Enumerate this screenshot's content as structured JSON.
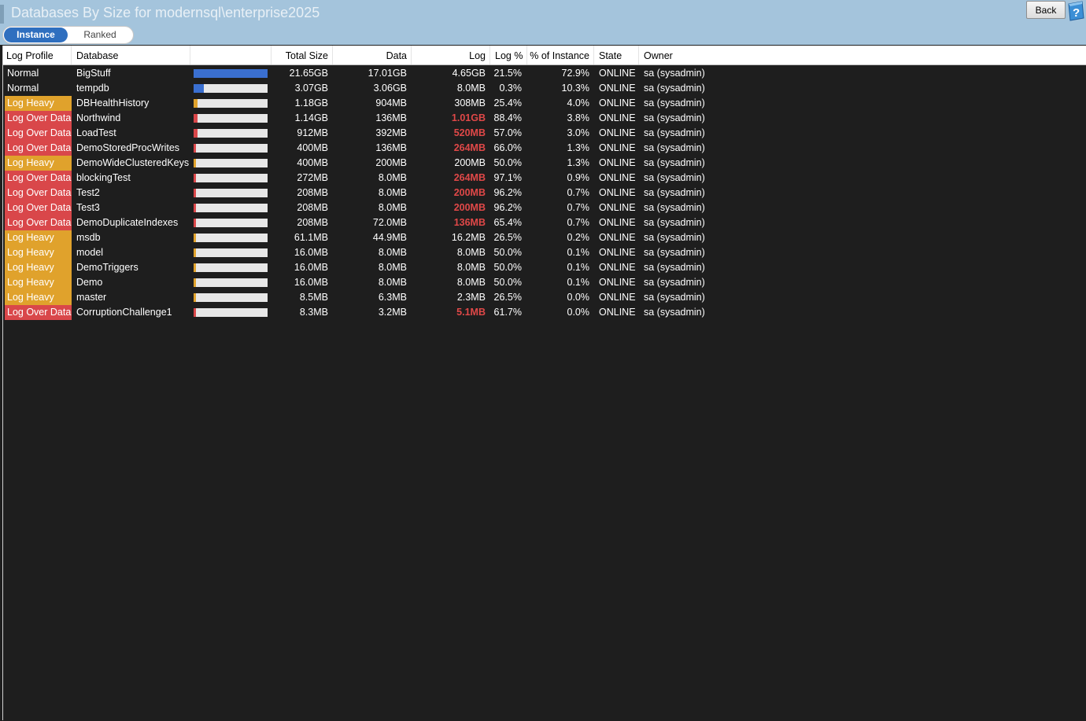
{
  "window": {
    "title": "Databases By Size for modernsql\\enterprise2025",
    "back_label": "Back"
  },
  "view_toggle": {
    "instance_label": "Instance",
    "ranked_label": "Ranked",
    "selected": "Instance"
  },
  "colors": {
    "normal": "#1e1e1e",
    "log_heavy": "#e0a22c",
    "log_over_data": "#d9474a",
    "bar_blue": "#3a6fd0",
    "bar_track": "#e7e7e7",
    "log_red_text": "#e04848"
  },
  "columns": [
    "Log Profile",
    "Database",
    "",
    "Total Size",
    "Data",
    "Log",
    "Log %",
    "% of Instance",
    "State",
    "Owner"
  ],
  "rows": [
    {
      "profile": "Normal",
      "database": "BigStuff",
      "total": "21.65GB",
      "data": "17.01GB",
      "log": "4.65GB",
      "log_pct": "21.5%",
      "pct_instance": "72.9%",
      "state": "ONLINE",
      "owner": "sa (sysadmin)",
      "bar_fraction": 1.0,
      "log_highlight": false
    },
    {
      "profile": "Normal",
      "database": "tempdb",
      "total": "3.07GB",
      "data": "3.06GB",
      "log": "8.0MB",
      "log_pct": "0.3%",
      "pct_instance": "10.3%",
      "state": "ONLINE",
      "owner": "sa (sysadmin)",
      "bar_fraction": 0.142,
      "log_highlight": false
    },
    {
      "profile": "Log Heavy",
      "database": "DBHealthHistory",
      "total": "1.18GB",
      "data": "904MB",
      "log": "308MB",
      "log_pct": "25.4%",
      "pct_instance": "4.0%",
      "state": "ONLINE",
      "owner": "sa (sysadmin)",
      "bar_fraction": 0.055,
      "log_highlight": false
    },
    {
      "profile": "Log Over Data",
      "database": "Northwind",
      "total": "1.14GB",
      "data": "136MB",
      "log": "1.01GB",
      "log_pct": "88.4%",
      "pct_instance": "3.8%",
      "state": "ONLINE",
      "owner": "sa (sysadmin)",
      "bar_fraction": 0.053,
      "log_highlight": true
    },
    {
      "profile": "Log Over Data",
      "database": "LoadTest",
      "total": "912MB",
      "data": "392MB",
      "log": "520MB",
      "log_pct": "57.0%",
      "pct_instance": "3.0%",
      "state": "ONLINE",
      "owner": "sa (sysadmin)",
      "bar_fraction": 0.042,
      "log_highlight": true
    },
    {
      "profile": "Log Over Data",
      "database": "DemoStoredProcWrites",
      "total": "400MB",
      "data": "136MB",
      "log": "264MB",
      "log_pct": "66.0%",
      "pct_instance": "1.3%",
      "state": "ONLINE",
      "owner": "sa (sysadmin)",
      "bar_fraction": 0.02,
      "log_highlight": true
    },
    {
      "profile": "Log Heavy",
      "database": "DemoWideClusteredKeys",
      "total": "400MB",
      "data": "200MB",
      "log": "200MB",
      "log_pct": "50.0%",
      "pct_instance": "1.3%",
      "state": "ONLINE",
      "owner": "sa (sysadmin)",
      "bar_fraction": 0.02,
      "log_highlight": false
    },
    {
      "profile": "Log Over Data",
      "database": "blockingTest",
      "total": "272MB",
      "data": "8.0MB",
      "log": "264MB",
      "log_pct": "97.1%",
      "pct_instance": "0.9%",
      "state": "ONLINE",
      "owner": "sa (sysadmin)",
      "bar_fraction": 0.015,
      "log_highlight": true
    },
    {
      "profile": "Log Over Data",
      "database": "Test2",
      "total": "208MB",
      "data": "8.0MB",
      "log": "200MB",
      "log_pct": "96.2%",
      "pct_instance": "0.7%",
      "state": "ONLINE",
      "owner": "sa (sysadmin)",
      "bar_fraction": 0.012,
      "log_highlight": true
    },
    {
      "profile": "Log Over Data",
      "database": "Test3",
      "total": "208MB",
      "data": "8.0MB",
      "log": "200MB",
      "log_pct": "96.2%",
      "pct_instance": "0.7%",
      "state": "ONLINE",
      "owner": "sa (sysadmin)",
      "bar_fraction": 0.012,
      "log_highlight": true
    },
    {
      "profile": "Log Over Data",
      "database": "DemoDuplicateIndexes",
      "total": "208MB",
      "data": "72.0MB",
      "log": "136MB",
      "log_pct": "65.4%",
      "pct_instance": "0.7%",
      "state": "ONLINE",
      "owner": "sa (sysadmin)",
      "bar_fraction": 0.012,
      "log_highlight": true
    },
    {
      "profile": "Log Heavy",
      "database": "msdb",
      "total": "61.1MB",
      "data": "44.9MB",
      "log": "16.2MB",
      "log_pct": "26.5%",
      "pct_instance": "0.2%",
      "state": "ONLINE",
      "owner": "sa (sysadmin)",
      "bar_fraction": 0.01,
      "log_highlight": false
    },
    {
      "profile": "Log Heavy",
      "database": "model",
      "total": "16.0MB",
      "data": "8.0MB",
      "log": "8.0MB",
      "log_pct": "50.0%",
      "pct_instance": "0.1%",
      "state": "ONLINE",
      "owner": "sa (sysadmin)",
      "bar_fraction": 0.01,
      "log_highlight": false
    },
    {
      "profile": "Log Heavy",
      "database": "DemoTriggers",
      "total": "16.0MB",
      "data": "8.0MB",
      "log": "8.0MB",
      "log_pct": "50.0%",
      "pct_instance": "0.1%",
      "state": "ONLINE",
      "owner": "sa (sysadmin)",
      "bar_fraction": 0.01,
      "log_highlight": false
    },
    {
      "profile": "Log Heavy",
      "database": "Demo",
      "total": "16.0MB",
      "data": "8.0MB",
      "log": "8.0MB",
      "log_pct": "50.0%",
      "pct_instance": "0.1%",
      "state": "ONLINE",
      "owner": "sa (sysadmin)",
      "bar_fraction": 0.01,
      "log_highlight": false
    },
    {
      "profile": "Log Heavy",
      "database": "master",
      "total": "8.5MB",
      "data": "6.3MB",
      "log": "2.3MB",
      "log_pct": "26.5%",
      "pct_instance": "0.0%",
      "state": "ONLINE",
      "owner": "sa (sysadmin)",
      "bar_fraction": 0.01,
      "log_highlight": false
    },
    {
      "profile": "Log Over Data",
      "database": "CorruptionChallenge1",
      "total": "8.3MB",
      "data": "3.2MB",
      "log": "5.1MB",
      "log_pct": "61.7%",
      "pct_instance": "0.0%",
      "state": "ONLINE",
      "owner": "sa (sysadmin)",
      "bar_fraction": 0.01,
      "log_highlight": true
    }
  ]
}
